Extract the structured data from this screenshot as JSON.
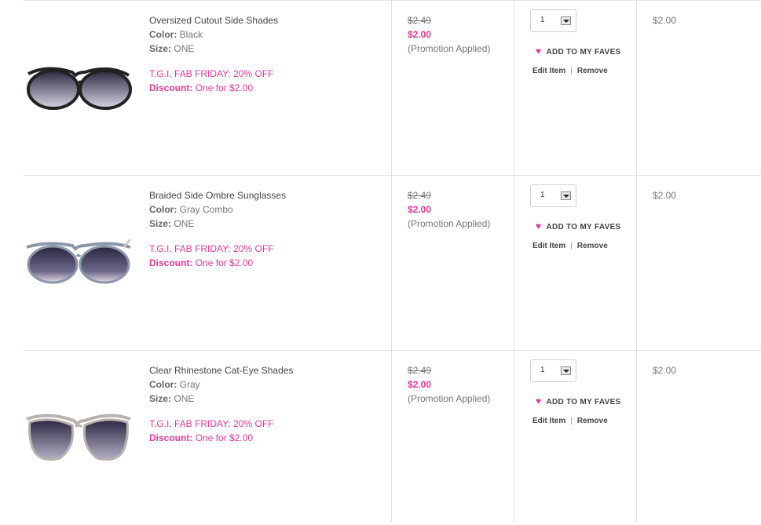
{
  "items": [
    {
      "name": "Oversized Cutout Side Shades",
      "color_label": "Color:",
      "color": "Black",
      "size_label": "Size:",
      "size": "ONE",
      "promotion": "T.G.I. FAB FRIDAY: 20% OFF",
      "discount_label": "Discount:",
      "discount": "One for $2.00",
      "original_price": "$2.49",
      "sale_price": "$2.00",
      "promo_note": "(Promotion Applied)",
      "quantity": "1",
      "faves_label": "ADD TO MY FAVES",
      "edit_label": "Edit Item",
      "separator": "|",
      "remove_label": "Remove",
      "total": "$2.00",
      "frame_color": "#222222"
    },
    {
      "name": "Braided Side Ombre Sunglasses",
      "color_label": "Color:",
      "color": "Gray Combo",
      "size_label": "Size:",
      "size": "ONE",
      "promotion": "T.G.I. FAB FRIDAY: 20% OFF",
      "discount_label": "Discount:",
      "discount": "One for $2.00",
      "original_price": "$2.49",
      "sale_price": "$2.00",
      "promo_note": "(Promotion Applied)",
      "quantity": "1",
      "faves_label": "ADD TO MY FAVES",
      "edit_label": "Edit Item",
      "separator": "|",
      "remove_label": "Remove",
      "total": "$2.00",
      "frame_color": "#8a97a8"
    },
    {
      "name": "Clear Rhinestone Cat-Eye Shades",
      "color_label": "Color:",
      "color": "Gray",
      "size_label": "Size:",
      "size": "ONE",
      "promotion": "T.G.I. FAB FRIDAY: 20% OFF",
      "discount_label": "Discount:",
      "discount": "One for $2.00",
      "original_price": "$2.49",
      "sale_price": "$2.00",
      "promo_note": "(Promotion Applied)",
      "quantity": "1",
      "faves_label": "ADD TO MY FAVES",
      "edit_label": "Edit Item",
      "separator": "|",
      "remove_label": "Remove",
      "total": "$2.00",
      "frame_color": "#b7b2ad"
    }
  ],
  "colors": {
    "accent": "#e1399a",
    "border": "#e3e3e3"
  }
}
